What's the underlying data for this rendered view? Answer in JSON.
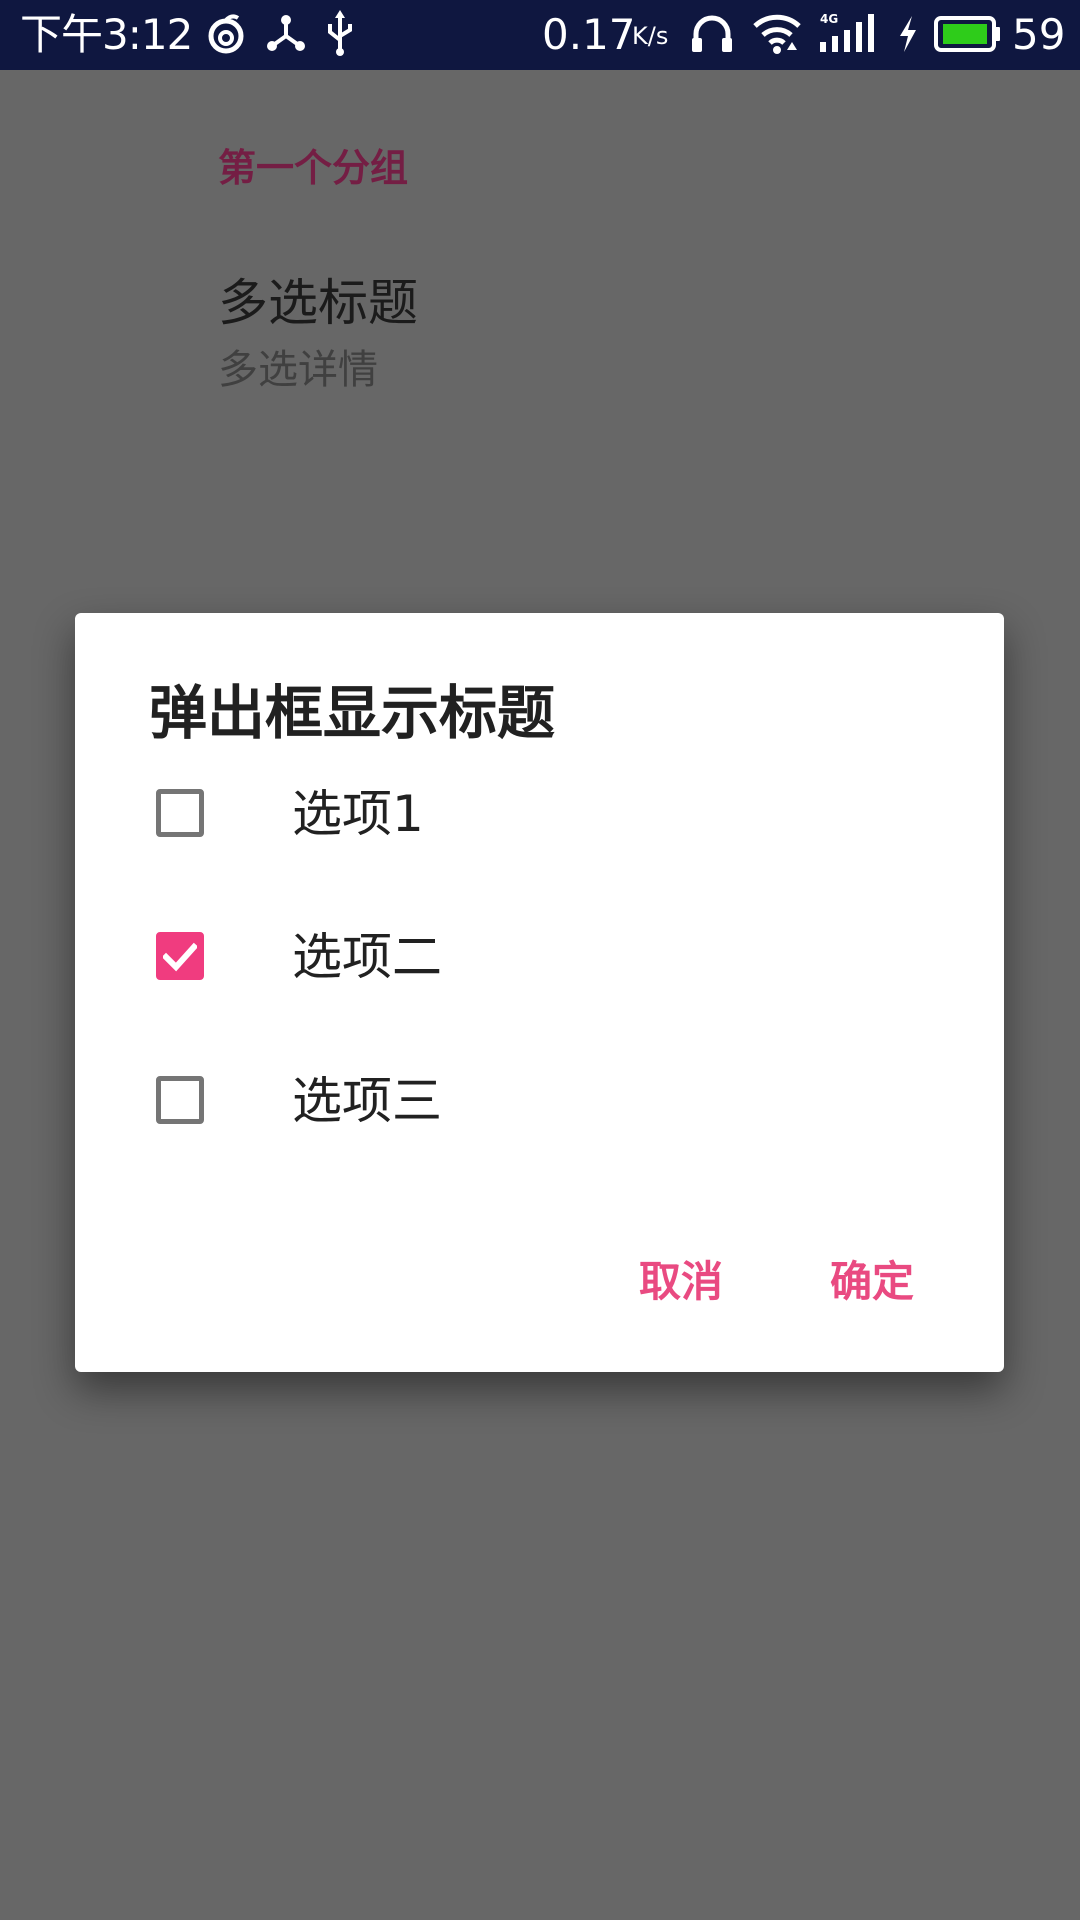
{
  "status_bar": {
    "time": "下午3:12",
    "net_speed": "0.17",
    "net_speed_unit": "K/s",
    "network_type": "4G",
    "battery_percent": "59",
    "icons": [
      "netease-music-icon",
      "share-icon",
      "usb-icon",
      "headphones-icon",
      "wifi-icon",
      "signal-icon",
      "charging-icon",
      "battery-icon"
    ]
  },
  "preferences": {
    "category": "第一个分组",
    "item_title": "多选标题",
    "item_summary": "多选详情"
  },
  "dialog": {
    "title": "弹出框显示标题",
    "options": [
      {
        "label": "选项1",
        "checked": false
      },
      {
        "label": "选项二",
        "checked": true
      },
      {
        "label": "选项三",
        "checked": false
      }
    ],
    "cancel_label": "取消",
    "confirm_label": "确定"
  },
  "colors": {
    "accent": "#f03c7f",
    "button_text": "#e94a81",
    "category_text": "#741e44",
    "status_bar": "#0f1740",
    "scrim": "#676767",
    "battery_fill": "#2ecc1a"
  }
}
